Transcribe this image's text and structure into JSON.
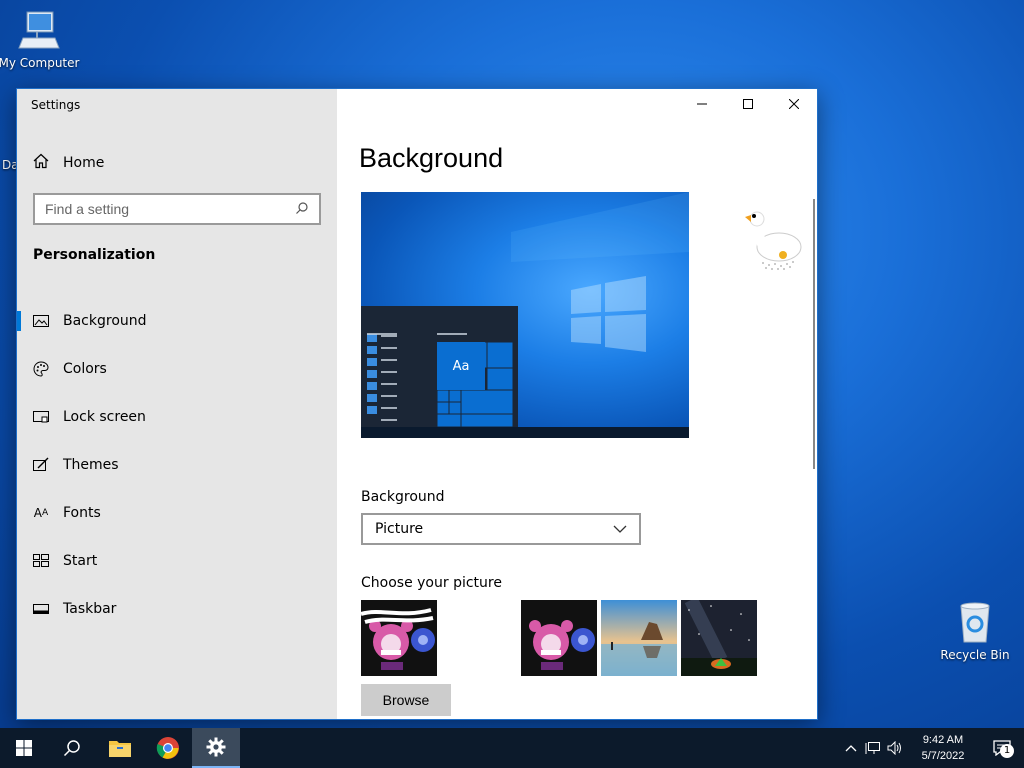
{
  "desktop": {
    "my_computer_label": "My Computer",
    "recycle_bin_label": "Recycle Bin",
    "partial_icon_label": "Da"
  },
  "window": {
    "title": "Settings",
    "home_label": "Home",
    "search_placeholder": "Find a setting",
    "section_heading": "Personalization",
    "nav_items": [
      {
        "label": "Background",
        "icon": "picture-icon",
        "active": true
      },
      {
        "label": "Colors",
        "icon": "palette-icon",
        "active": false
      },
      {
        "label": "Lock screen",
        "icon": "lock-screen-icon",
        "active": false
      },
      {
        "label": "Themes",
        "icon": "themes-icon",
        "active": false
      },
      {
        "label": "Fonts",
        "icon": "fonts-icon",
        "active": false
      },
      {
        "label": "Start",
        "icon": "start-icon",
        "active": false
      },
      {
        "label": "Taskbar",
        "icon": "taskbar-icon",
        "active": false
      }
    ]
  },
  "content": {
    "page_title": "Background",
    "preview_tile_text": "Aa",
    "background_label": "Background",
    "background_value": "Picture",
    "choose_label": "Choose your picture",
    "browse_label": "Browse"
  },
  "taskbar": {
    "time": "9:42 AM",
    "date": "5/7/2022",
    "notification_count": "1"
  },
  "colors": {
    "accent": "#0078d7",
    "taskbar_bg": "#0c1a2b",
    "sidebar_bg": "#e6e6e6"
  }
}
